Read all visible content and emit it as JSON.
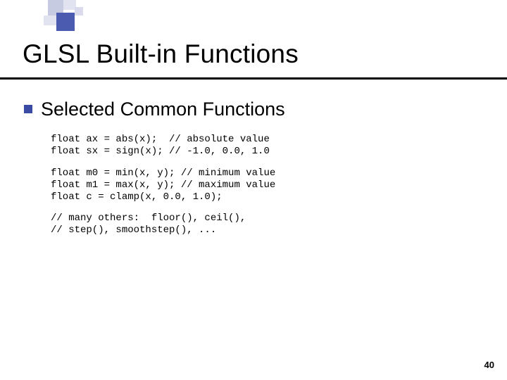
{
  "title": "GLSL Built-in Functions",
  "subheading": "Selected Common Functions",
  "code_block1": "float ax = abs(x);  // absolute value\nfloat sx = sign(x); // -1.0, 0.0, 1.0",
  "code_block2": "float m0 = min(x, y); // minimum value\nfloat m1 = max(x, y); // maximum value\nfloat c = clamp(x, 0.0, 1.0);",
  "code_block3": "// many others:  floor(), ceil(),\n// step(), smoothstep(), ...",
  "page_number": "40"
}
